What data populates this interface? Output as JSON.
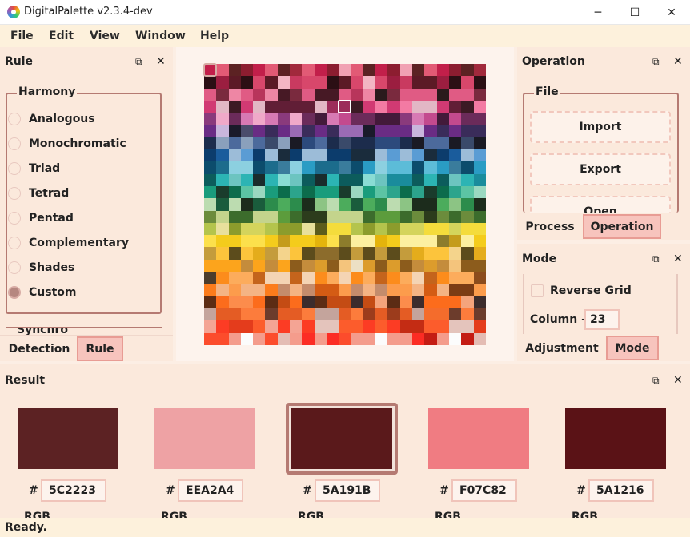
{
  "window": {
    "title": "DigitalPalette v2.3.4-dev",
    "minimize": "─",
    "maximize": "☐",
    "close": "✕"
  },
  "menu": [
    "File",
    "Edit",
    "View",
    "Window",
    "Help"
  ],
  "rule_panel": {
    "title": "Rule",
    "harmony_label": "Harmony",
    "options": [
      "Analogous",
      "Monochromatic",
      "Triad",
      "Tetrad",
      "Pentad",
      "Complementary",
      "Shades",
      "Custom"
    ],
    "selected": "Custom",
    "next_group_label": "Synchro",
    "tabs": [
      "Detection",
      "Rule"
    ],
    "active_tab": "Rule"
  },
  "operation_panel": {
    "title": "Operation",
    "file_group": "File",
    "buttons": [
      "Import",
      "Export",
      "Open"
    ],
    "tabs": [
      "Process",
      "Operation"
    ],
    "active_tab": "Operation"
  },
  "mode_panel": {
    "title": "Mode",
    "reverse_grid_label": "Reverse Grid",
    "reverse_grid_checked": false,
    "column_label": "Column -",
    "column_value": "23",
    "tabs": [
      "Adjustment",
      "Mode"
    ],
    "active_tab": "Mode"
  },
  "result_panel": {
    "title": "Result",
    "hash": "#",
    "rgb_label": "RGB",
    "selected_index": 2,
    "swatches": [
      {
        "hex": "5C2223",
        "color": "#5C2223"
      },
      {
        "hex": "EEA2A4",
        "color": "#EEA2A4"
      },
      {
        "hex": "5A191B",
        "color": "#5A191B"
      },
      {
        "hex": "F07C82",
        "color": "#F07C82"
      },
      {
        "hex": "5A1216",
        "color": "#5A1216"
      }
    ]
  },
  "status": "Ready.",
  "colors": {
    "accent": "#b57a72",
    "tab_active": "#f7c4bd",
    "panel_bg": "#fbe9dc",
    "menubar": "#fdf1dc"
  },
  "grid": {
    "columns": 23,
    "rows": 23,
    "row_palettes": [
      [
        "#5c2223",
        "#8c1d30",
        "#c21f4a",
        "#e25a75",
        "#f1a1b3",
        "#a1293c"
      ],
      [
        "#9b1e40",
        "#d8476b",
        "#5c1a26",
        "#f3b6c3",
        "#c93a60",
        "#2b0f14"
      ],
      [
        "#471925",
        "#7a2a3e",
        "#e05b84",
        "#ee86a4",
        "#b8355b",
        "#2a1a1c"
      ],
      [
        "#3c1a24",
        "#d13a73",
        "#f37aa3",
        "#9c2c5a",
        "#e2b7c5",
        "#611e36"
      ],
      [
        "#6b2b5a",
        "#c34a8e",
        "#f0a9c9",
        "#8a3a7c",
        "#431a3a",
        "#d77ab4"
      ],
      [
        "#6a2c84",
        "#9a6bb4",
        "#3a2c5a",
        "#c8b6dc",
        "#1a1a2a",
        "#4a4c6c"
      ],
      [
        "#1c2c4c",
        "#2c4a7c",
        "#4c6a9c",
        "#1a1a24",
        "#8aa0bc",
        "#3a4a6a"
      ],
      [
        "#1a5c9c",
        "#2c7cbc",
        "#0c3c6c",
        "#5a9cd4",
        "#1a2c3c",
        "#9cbcd8"
      ],
      [
        "#2a9cc4",
        "#5cbcd8",
        "#1c6c8c",
        "#0c4c6c",
        "#8cd0e0",
        "#3a7c9c"
      ],
      [
        "#1a8c9c",
        "#2cb4b4",
        "#0c5c5c",
        "#6cc4c0",
        "#1a2c2c",
        "#8adcd4"
      ],
      [
        "#1a9c7c",
        "#2ca48c",
        "#0c6c4c",
        "#5cc4a4",
        "#1a3c2c",
        "#9ad8c0"
      ],
      [
        "#2c8c4c",
        "#4cac5c",
        "#1a5c3c",
        "#8cc484",
        "#1c2c1c",
        "#bcdcb0"
      ],
      [
        "#5c9c3c",
        "#8cbc4c",
        "#3c6c2c",
        "#c4d48c",
        "#2c3c1c",
        "#6c8c3c"
      ],
      [
        "#b4c44c",
        "#d4d45c",
        "#8c9c2c",
        "#f4dc3c",
        "#5c5c1c",
        "#e8e09c"
      ],
      [
        "#f4cc1c",
        "#e4b40c",
        "#fce04c",
        "#c49c1c",
        "#8c7c2c",
        "#fcf0a0"
      ],
      [
        "#5c4c1c",
        "#c49c3c",
        "#e4ac1c",
        "#fcc43c",
        "#8c6c2c",
        "#f4d48c"
      ],
      [
        "#fca41c",
        "#c48c3c",
        "#8c5c1c",
        "#f4c47c",
        "#dc9c2c",
        "#ece0c4"
      ],
      [
        "#fc8c1c",
        "#c4641c",
        "#fcac5c",
        "#8c4c1c",
        "#f4d4b4",
        "#4c3c2c"
      ],
      [
        "#fc7c1c",
        "#d45c14",
        "#fc9c4c",
        "#7c3c14",
        "#f4b484",
        "#c48c6c"
      ],
      [
        "#fc6c1c",
        "#c44c14",
        "#fc8c4c",
        "#5c2c14",
        "#f4a47c",
        "#3c2c2c"
      ],
      [
        "#e45c24",
        "#fc7c3c",
        "#9c3c1c",
        "#c4a49c",
        "#f46c2c",
        "#6c3c2c"
      ],
      [
        "#e43c1c",
        "#fc5c2c",
        "#c42c14",
        "#f4a494",
        "#fc3c24",
        "#e4c4bc"
      ],
      [
        "#c41c14",
        "#fc4c2c",
        "#e4bcb4",
        "#fc2c24",
        "#f49c8c",
        "#fcfcfc"
      ]
    ]
  }
}
